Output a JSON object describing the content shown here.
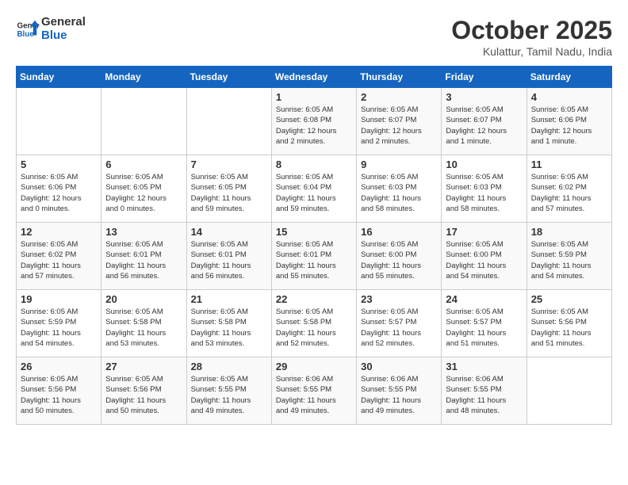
{
  "header": {
    "logo_line1": "General",
    "logo_line2": "Blue",
    "month_title": "October 2025",
    "subtitle": "Kulattur, Tamil Nadu, India"
  },
  "weekdays": [
    "Sunday",
    "Monday",
    "Tuesday",
    "Wednesday",
    "Thursday",
    "Friday",
    "Saturday"
  ],
  "weeks": [
    [
      {
        "day": "",
        "info": ""
      },
      {
        "day": "",
        "info": ""
      },
      {
        "day": "",
        "info": ""
      },
      {
        "day": "1",
        "info": "Sunrise: 6:05 AM\nSunset: 6:08 PM\nDaylight: 12 hours\nand 2 minutes."
      },
      {
        "day": "2",
        "info": "Sunrise: 6:05 AM\nSunset: 6:07 PM\nDaylight: 12 hours\nand 2 minutes."
      },
      {
        "day": "3",
        "info": "Sunrise: 6:05 AM\nSunset: 6:07 PM\nDaylight: 12 hours\nand 1 minute."
      },
      {
        "day": "4",
        "info": "Sunrise: 6:05 AM\nSunset: 6:06 PM\nDaylight: 12 hours\nand 1 minute."
      }
    ],
    [
      {
        "day": "5",
        "info": "Sunrise: 6:05 AM\nSunset: 6:06 PM\nDaylight: 12 hours\nand 0 minutes."
      },
      {
        "day": "6",
        "info": "Sunrise: 6:05 AM\nSunset: 6:05 PM\nDaylight: 12 hours\nand 0 minutes."
      },
      {
        "day": "7",
        "info": "Sunrise: 6:05 AM\nSunset: 6:05 PM\nDaylight: 11 hours\nand 59 minutes."
      },
      {
        "day": "8",
        "info": "Sunrise: 6:05 AM\nSunset: 6:04 PM\nDaylight: 11 hours\nand 59 minutes."
      },
      {
        "day": "9",
        "info": "Sunrise: 6:05 AM\nSunset: 6:03 PM\nDaylight: 11 hours\nand 58 minutes."
      },
      {
        "day": "10",
        "info": "Sunrise: 6:05 AM\nSunset: 6:03 PM\nDaylight: 11 hours\nand 58 minutes."
      },
      {
        "day": "11",
        "info": "Sunrise: 6:05 AM\nSunset: 6:02 PM\nDaylight: 11 hours\nand 57 minutes."
      }
    ],
    [
      {
        "day": "12",
        "info": "Sunrise: 6:05 AM\nSunset: 6:02 PM\nDaylight: 11 hours\nand 57 minutes."
      },
      {
        "day": "13",
        "info": "Sunrise: 6:05 AM\nSunset: 6:01 PM\nDaylight: 11 hours\nand 56 minutes."
      },
      {
        "day": "14",
        "info": "Sunrise: 6:05 AM\nSunset: 6:01 PM\nDaylight: 11 hours\nand 56 minutes."
      },
      {
        "day": "15",
        "info": "Sunrise: 6:05 AM\nSunset: 6:01 PM\nDaylight: 11 hours\nand 55 minutes."
      },
      {
        "day": "16",
        "info": "Sunrise: 6:05 AM\nSunset: 6:00 PM\nDaylight: 11 hours\nand 55 minutes."
      },
      {
        "day": "17",
        "info": "Sunrise: 6:05 AM\nSunset: 6:00 PM\nDaylight: 11 hours\nand 54 minutes."
      },
      {
        "day": "18",
        "info": "Sunrise: 6:05 AM\nSunset: 5:59 PM\nDaylight: 11 hours\nand 54 minutes."
      }
    ],
    [
      {
        "day": "19",
        "info": "Sunrise: 6:05 AM\nSunset: 5:59 PM\nDaylight: 11 hours\nand 54 minutes."
      },
      {
        "day": "20",
        "info": "Sunrise: 6:05 AM\nSunset: 5:58 PM\nDaylight: 11 hours\nand 53 minutes."
      },
      {
        "day": "21",
        "info": "Sunrise: 6:05 AM\nSunset: 5:58 PM\nDaylight: 11 hours\nand 53 minutes."
      },
      {
        "day": "22",
        "info": "Sunrise: 6:05 AM\nSunset: 5:58 PM\nDaylight: 11 hours\nand 52 minutes."
      },
      {
        "day": "23",
        "info": "Sunrise: 6:05 AM\nSunset: 5:57 PM\nDaylight: 11 hours\nand 52 minutes."
      },
      {
        "day": "24",
        "info": "Sunrise: 6:05 AM\nSunset: 5:57 PM\nDaylight: 11 hours\nand 51 minutes."
      },
      {
        "day": "25",
        "info": "Sunrise: 6:05 AM\nSunset: 5:56 PM\nDaylight: 11 hours\nand 51 minutes."
      }
    ],
    [
      {
        "day": "26",
        "info": "Sunrise: 6:05 AM\nSunset: 5:56 PM\nDaylight: 11 hours\nand 50 minutes."
      },
      {
        "day": "27",
        "info": "Sunrise: 6:05 AM\nSunset: 5:56 PM\nDaylight: 11 hours\nand 50 minutes."
      },
      {
        "day": "28",
        "info": "Sunrise: 6:05 AM\nSunset: 5:55 PM\nDaylight: 11 hours\nand 49 minutes."
      },
      {
        "day": "29",
        "info": "Sunrise: 6:06 AM\nSunset: 5:55 PM\nDaylight: 11 hours\nand 49 minutes."
      },
      {
        "day": "30",
        "info": "Sunrise: 6:06 AM\nSunset: 5:55 PM\nDaylight: 11 hours\nand 49 minutes."
      },
      {
        "day": "31",
        "info": "Sunrise: 6:06 AM\nSunset: 5:55 PM\nDaylight: 11 hours\nand 48 minutes."
      },
      {
        "day": "",
        "info": ""
      }
    ]
  ]
}
